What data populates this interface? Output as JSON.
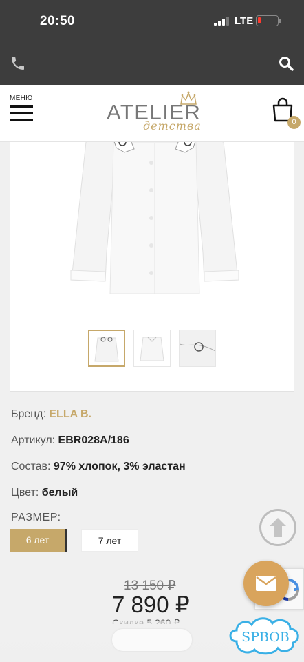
{
  "status": {
    "time": "20:50",
    "network": "LTE"
  },
  "header": {
    "menu_label": "МЕНЮ",
    "logo_main": "ATELIER",
    "logo_sub": "детства",
    "cart_count": "0"
  },
  "product": {
    "brand_label": "Бренд:",
    "brand_value": "ELLA B.",
    "sku_label": "Артикул:",
    "sku_value": "EBR028A/186",
    "composition_label": "Состав:",
    "composition_value": "97% хлопок, 3% эластан",
    "color_label": "Цвет:",
    "color_value": "белый",
    "size_label": "РАЗМЕР:",
    "sizes": [
      "6 лет",
      "7 лет"
    ],
    "selected_size": "6 лет",
    "old_price": "13 150 ₽",
    "price": "7 890 ₽",
    "saving": "Скидка 5 260 ₽"
  },
  "badge_text": "SPBOB",
  "colors": {
    "accent": "#c6a86a",
    "dark_bar": "#3d3d3d",
    "fab": "#d9a45c"
  }
}
